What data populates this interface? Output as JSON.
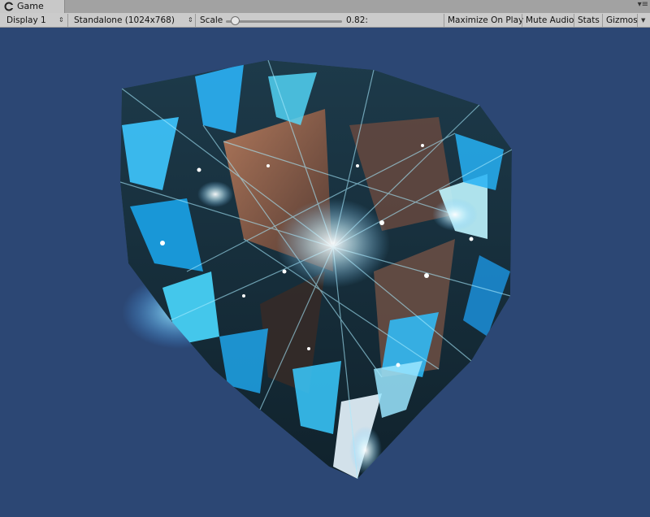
{
  "window": {
    "tab_label": "Game"
  },
  "toolbar": {
    "display_label": "Display 1",
    "resolution_label": "Standalone (1024x768)",
    "scale_label": "Scale",
    "scale_value_text": "0.82:",
    "scale_level": 0.05,
    "maximize_label": "Maximize On Play",
    "mute_label": "Mute Audio",
    "stats_label": "Stats",
    "gizmos_label": "Gizmos"
  },
  "viewport": {
    "background_color": "#2c4774"
  }
}
